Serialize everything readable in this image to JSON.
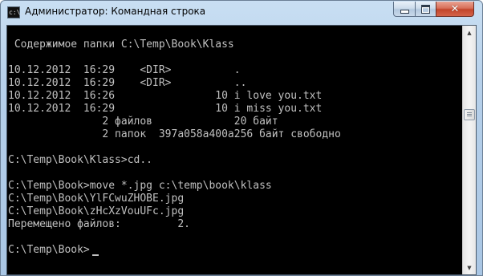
{
  "window": {
    "title": "Администратор: Командная строка",
    "icon": "console-icon",
    "icon_glyph": "c:\\."
  },
  "controls": {
    "minimize_icon": "minimize-icon",
    "maximize_icon": "maximize-icon",
    "close_icon": "close-icon",
    "close_glyph": "✕"
  },
  "console": {
    "foreground": "#c0c0c0",
    "background": "#000000",
    "lines": [
      "",
      " Содержимое папки C:\\Temp\\Book\\Klass",
      "",
      "10.12.2012  16:29    <DIR>          .",
      "10.12.2012  16:29    <DIR>          ..",
      "10.12.2012  16:26                10 i love you.txt",
      "10.12.2012  16:29                10 i miss you.txt",
      "               2 файлов             20 байт",
      "               2 папок  397a058a400a256 байт свободно",
      "",
      "C:\\Temp\\Book\\Klass>cd..",
      "",
      "C:\\Temp\\Book>move *.jpg c:\\temp\\book\\klass",
      "C:\\Temp\\Book\\YlFCwuZHOBE.jpg",
      "C:\\Temp\\Book\\zHcXzVouUFc.jpg",
      "Перемещено файлов:         2.",
      "",
      "C:\\Temp\\Book>"
    ]
  },
  "scrollbar": {
    "up_arrow": "▲",
    "down_arrow": "▼"
  }
}
